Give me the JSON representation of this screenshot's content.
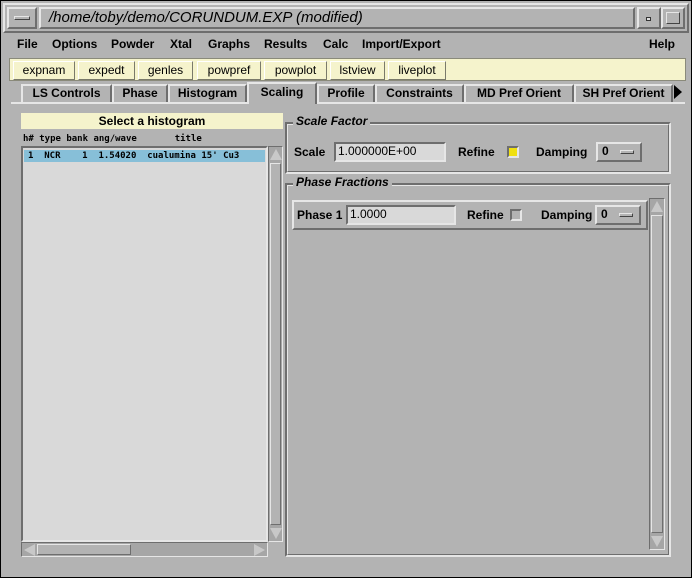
{
  "window": {
    "title": "/home/toby/demo/CORUNDUM.EXP (modified)"
  },
  "menubar": {
    "items": [
      "File",
      "Options",
      "Powder",
      "Xtal",
      "Graphs",
      "Results",
      "Calc",
      "Import/Export"
    ],
    "help": "Help"
  },
  "toolbar": {
    "buttons": [
      "expnam",
      "expedt",
      "genles",
      "powpref",
      "powplot",
      "lstview",
      "liveplot"
    ]
  },
  "tabs": {
    "items": [
      "LS Controls",
      "Phase",
      "Histogram",
      "Scaling",
      "Profile",
      "Constraints",
      "MD Pref Orient",
      "SH Pref Orient"
    ],
    "active": "Scaling"
  },
  "histogram_list": {
    "heading": "Select a histogram",
    "columns": "h# type bank ang/wave       title",
    "rows": [
      "1  NCR    1  1.54020  cualumina 15' Cu3"
    ]
  },
  "scale_factor": {
    "group_label": "Scale Factor",
    "scale_label": "Scale",
    "scale_value": "1.000000E+00",
    "refine_label": "Refine",
    "refine_checked": true,
    "damping_label": "Damping",
    "damping_value": "0"
  },
  "phase_fractions": {
    "group_label": "Phase Fractions",
    "rows": [
      {
        "phase_label": "Phase 1",
        "value": "1.0000",
        "refine_label": "Refine",
        "refine_checked": false,
        "damping_label": "Damping",
        "damping_value": "0"
      }
    ]
  },
  "colors": {
    "background": "#b3b3b3",
    "toolbar_bg": "#f5f3cc",
    "selection": "#87bfd8",
    "refine_on": "#f0e010",
    "entry_bg": "#d9d9d9"
  }
}
